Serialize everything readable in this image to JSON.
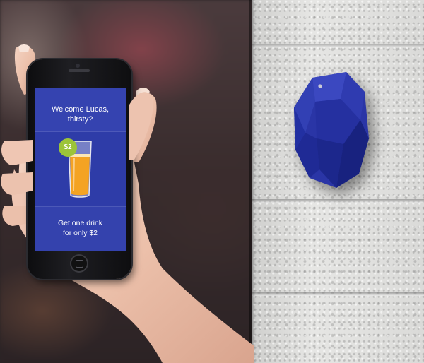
{
  "scene": {
    "description_colors": {
      "beacon": "#2a35a6",
      "screen": "#2d3ba6",
      "badge": "#9cc43a",
      "wall": "#dcdcda"
    }
  },
  "phone_screen": {
    "greeting_line1": "Welcome Lucas,",
    "greeting_line2": "thirsty?",
    "price_badge": "$2",
    "offer_line1": "Get one drink",
    "offer_line2": "for only $2",
    "icon": "drink-glass-icon"
  }
}
